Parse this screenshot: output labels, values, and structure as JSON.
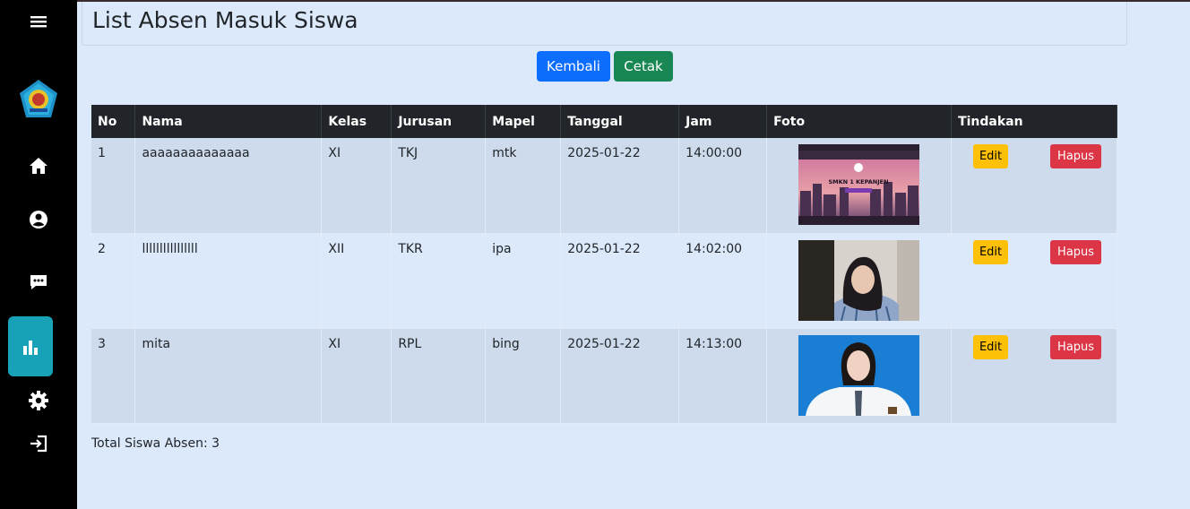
{
  "page": {
    "title": "List Absen Masuk Siswa",
    "total_label": "Total Siswa Absen: 3"
  },
  "sidebar": {
    "icons": [
      "menu-icon",
      "school-logo",
      "home-icon",
      "user-icon",
      "chat-icon",
      "chart-icon",
      "gear-icon",
      "logout-icon"
    ],
    "active": "chart-icon",
    "active_color": "#17a2b8"
  },
  "buttons": {
    "back": "Kembali",
    "print": "Cetak"
  },
  "table": {
    "headers": [
      "No",
      "Nama",
      "Kelas",
      "Jurusan",
      "Mapel",
      "Tanggal",
      "Jam",
      "Foto",
      "Tindakan"
    ],
    "rows": [
      {
        "no": "1",
        "nama": "aaaaaaaaaaaaaa",
        "kelas": "XI",
        "jurusan": "TKJ",
        "mapel": "mtk",
        "tanggal": "2025-01-22",
        "jam": "14:00:00",
        "edit": "Edit",
        "hapus": "Hapus"
      },
      {
        "no": "2",
        "nama": "llllllllllllllll",
        "kelas": "XII",
        "jurusan": "TKR",
        "mapel": "ipa",
        "tanggal": "2025-01-22",
        "jam": "14:02:00",
        "edit": "Edit",
        "hapus": "Hapus"
      },
      {
        "no": "3",
        "nama": "mita",
        "kelas": "XI",
        "jurusan": "RPL",
        "mapel": "bing",
        "tanggal": "2025-01-22",
        "jam": "14:13:00",
        "edit": "Edit",
        "hapus": "Hapus"
      }
    ]
  },
  "photo_1_text": "SMKN 1 KEPANJEN",
  "colors": {
    "background": "#dbe9fb",
    "sidebar": "#000000",
    "header_row": "#212529",
    "kembali": "#0d6efd",
    "cetak": "#198754",
    "edit": "#ffc107",
    "hapus": "#dc3545"
  }
}
